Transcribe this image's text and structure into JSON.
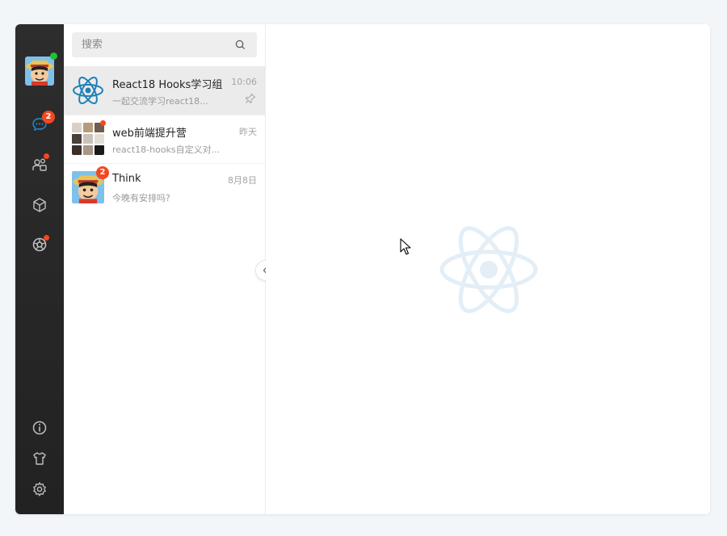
{
  "search": {
    "placeholder": "搜索"
  },
  "rail": {
    "chat_badge": "2"
  },
  "chats": [
    {
      "name": "React18 Hooks学习组",
      "time": "10:06",
      "preview": "一起交流学习react18...",
      "pinned": true,
      "active": true
    },
    {
      "name": "web前端提升营",
      "time": "昨天",
      "preview": "react18-hooks自定义对...",
      "pinned": false,
      "active": false
    },
    {
      "name": "Think",
      "time": "8月8日",
      "preview": "今晚有安排吗?",
      "badge": "2",
      "pinned": false,
      "active": false
    }
  ],
  "colors": {
    "rail": "#2b2b2b",
    "accent_blue": "#1e88c9",
    "badge": "#f5471f",
    "online": "#20c03a",
    "watermark": "#e6f0f8"
  }
}
